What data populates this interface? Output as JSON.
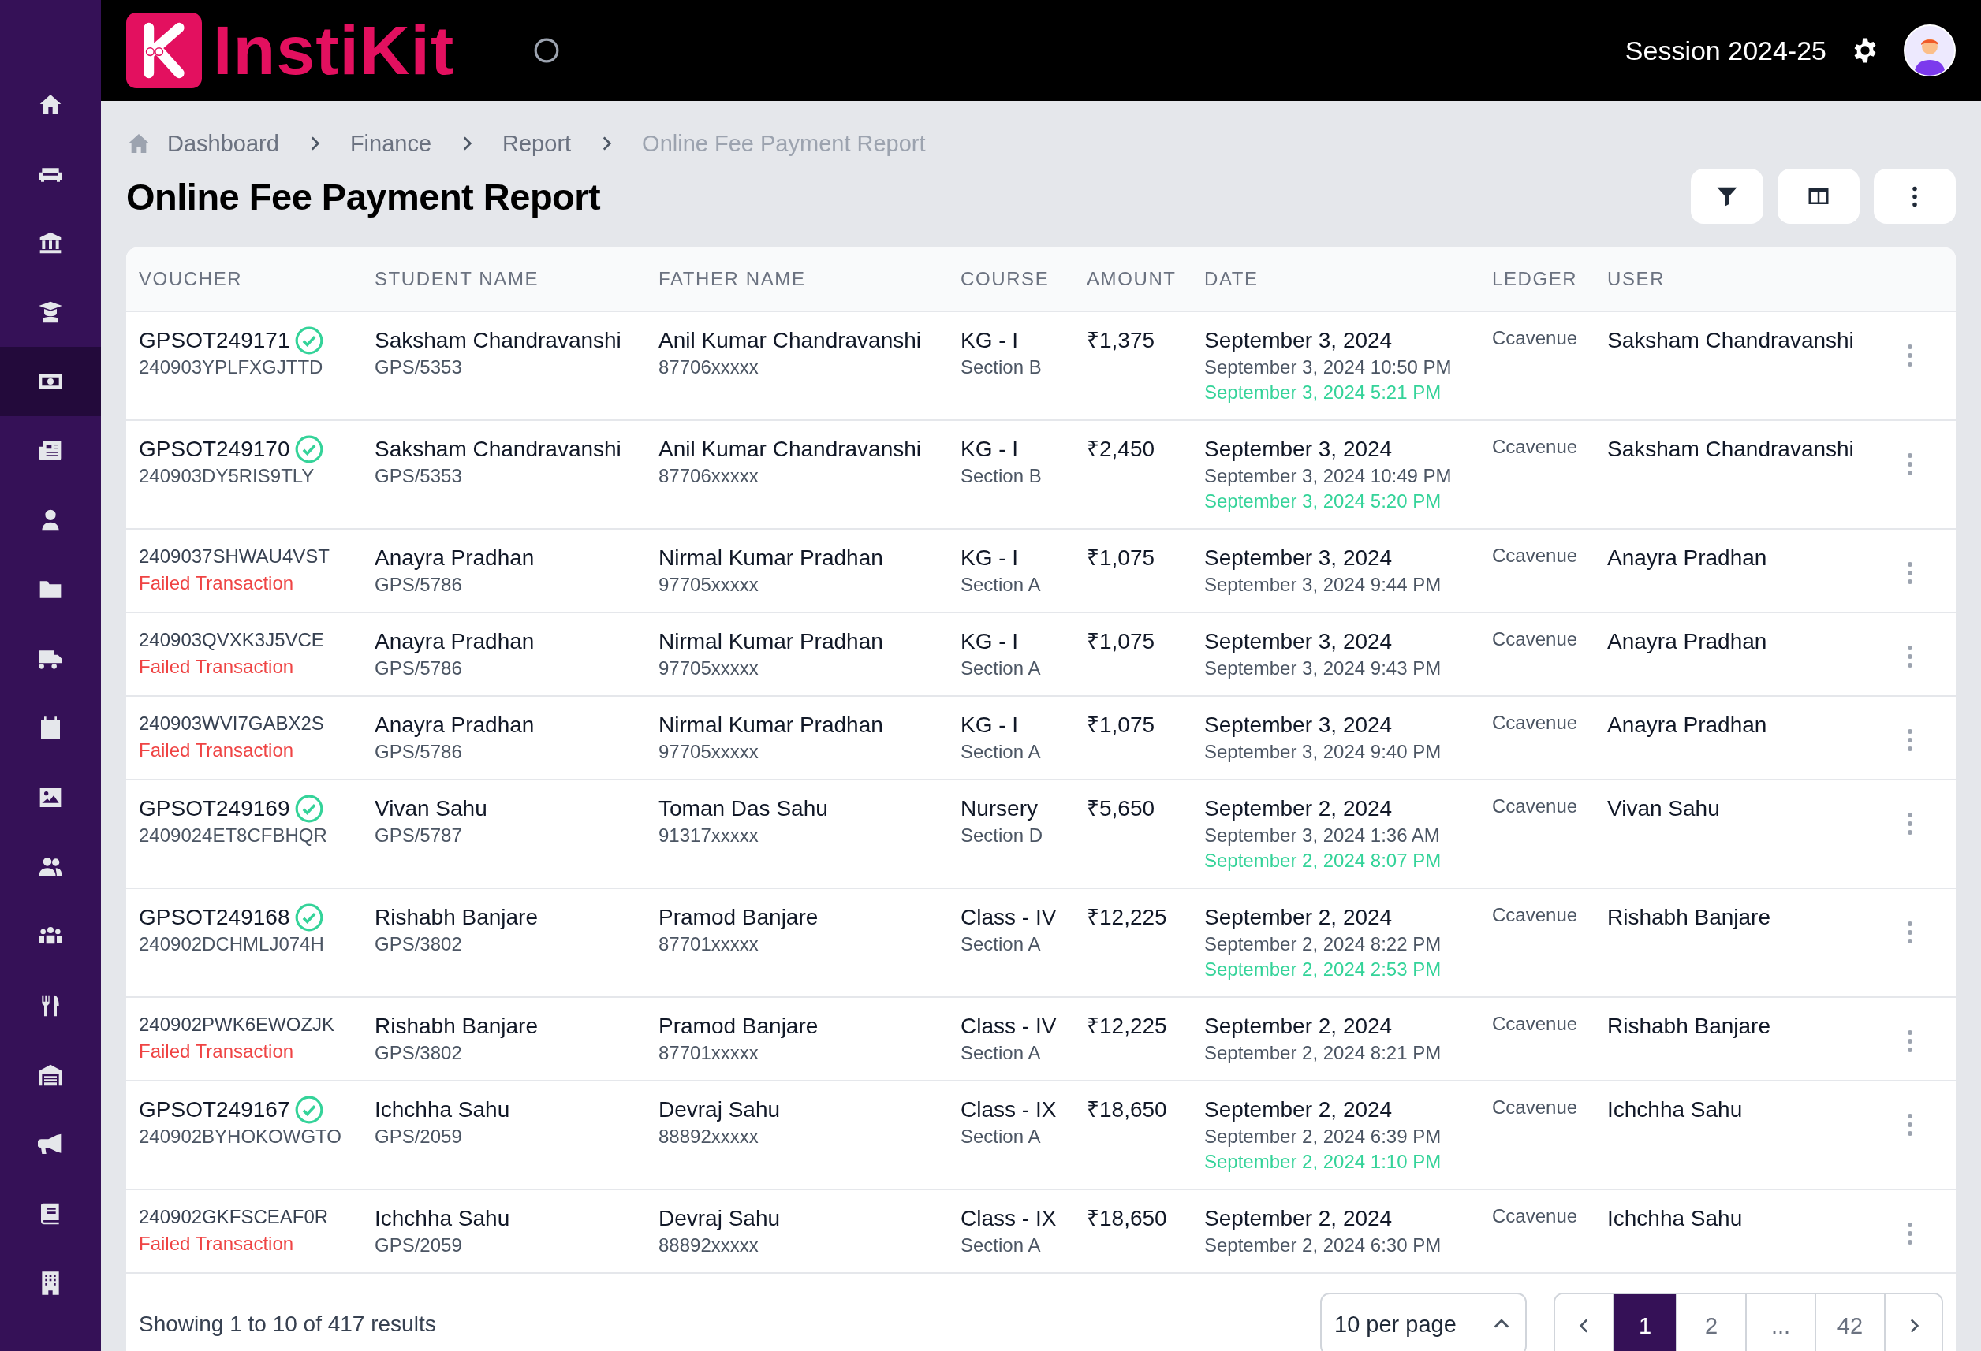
{
  "sidebar": {
    "items": [
      {
        "selected": false
      },
      {
        "selected": false
      },
      {
        "selected": false
      },
      {
        "selected": false
      },
      {
        "selected": true
      },
      {
        "selected": false
      },
      {
        "selected": false
      },
      {
        "selected": false
      },
      {
        "selected": false
      },
      {
        "selected": false
      },
      {
        "selected": false
      },
      {
        "selected": false
      },
      {
        "selected": false
      },
      {
        "selected": false
      },
      {
        "selected": false
      },
      {
        "selected": false
      },
      {
        "selected": false
      },
      {
        "selected": false
      }
    ]
  },
  "header": {
    "logo_text": "InstiKit",
    "session": "Session 2024-25"
  },
  "breadcrumb": [
    "Dashboard",
    "Finance",
    "Report",
    "Online Fee Payment Report"
  ],
  "title": "Online Fee Payment Report",
  "table": {
    "columns": [
      "VOUCHER",
      "STUDENT NAME",
      "FATHER NAME",
      "COURSE",
      "AMOUNT",
      "DATE",
      "LEDGER",
      "USER"
    ],
    "rows": [
      {
        "kind": "paid",
        "voucher_no": "GPSOT249171",
        "reference": "240903YPLFXGJTTD",
        "student": "Saksham Chandravanshi",
        "admission_no": "GPS/5353",
        "father": "Anil Kumar Chandravanshi",
        "contact": "87706xxxxx",
        "course": "KG - I",
        "section": "Section B",
        "amount": "₹1,375",
        "date": "September 3, 2024",
        "created_at": "September 3, 2024 10:50 PM",
        "paid_at": "September 3, 2024 5:21 PM",
        "ledger": "Ccavenue",
        "user": "Saksham Chandravanshi"
      },
      {
        "kind": "paid",
        "voucher_no": "GPSOT249170",
        "reference": "240903DY5RIS9TLY",
        "student": "Saksham Chandravanshi",
        "admission_no": "GPS/5353",
        "father": "Anil Kumar Chandravanshi",
        "contact": "87706xxxxx",
        "course": "KG - I",
        "section": "Section B",
        "amount": "₹2,450",
        "date": "September 3, 2024",
        "created_at": "September 3, 2024 10:49 PM",
        "paid_at": "September 3, 2024 5:20 PM",
        "ledger": "Ccavenue",
        "user": "Saksham Chandravanshi"
      },
      {
        "kind": "failed",
        "reference": "2409037SHWAU4VST",
        "status_text": "Failed Transaction",
        "student": "Anayra Pradhan",
        "admission_no": "GPS/5786",
        "father": "Nirmal Kumar Pradhan",
        "contact": "97705xxxxx",
        "course": "KG - I",
        "section": "Section A",
        "amount": "₹1,075",
        "date": "September 3, 2024",
        "created_at": "September 3, 2024 9:44 PM",
        "ledger": "Ccavenue",
        "user": "Anayra Pradhan"
      },
      {
        "kind": "failed",
        "reference": "240903QVXK3J5VCE",
        "status_text": "Failed Transaction",
        "student": "Anayra Pradhan",
        "admission_no": "GPS/5786",
        "father": "Nirmal Kumar Pradhan",
        "contact": "97705xxxxx",
        "course": "KG - I",
        "section": "Section A",
        "amount": "₹1,075",
        "date": "September 3, 2024",
        "created_at": "September 3, 2024 9:43 PM",
        "ledger": "Ccavenue",
        "user": "Anayra Pradhan"
      },
      {
        "kind": "failed",
        "reference": "240903WVI7GABX2S",
        "status_text": "Failed Transaction",
        "student": "Anayra Pradhan",
        "admission_no": "GPS/5786",
        "father": "Nirmal Kumar Pradhan",
        "contact": "97705xxxxx",
        "course": "KG - I",
        "section": "Section A",
        "amount": "₹1,075",
        "date": "September 3, 2024",
        "created_at": "September 3, 2024 9:40 PM",
        "ledger": "Ccavenue",
        "user": "Anayra Pradhan"
      },
      {
        "kind": "paid",
        "voucher_no": "GPSOT249169",
        "reference": "2409024ET8CFBHQR",
        "student": "Vivan Sahu",
        "admission_no": "GPS/5787",
        "father": "Toman Das Sahu",
        "contact": "91317xxxxx",
        "course": "Nursery",
        "section": "Section D",
        "amount": "₹5,650",
        "date": "September 2, 2024",
        "created_at": "September 3, 2024 1:36 AM",
        "paid_at": "September 2, 2024 8:07 PM",
        "ledger": "Ccavenue",
        "user": "Vivan Sahu"
      },
      {
        "kind": "paid",
        "voucher_no": "GPSOT249168",
        "reference": "240902DCHMLJ074H",
        "student": "Rishabh Banjare",
        "admission_no": "GPS/3802",
        "father": "Pramod Banjare",
        "contact": "87701xxxxx",
        "course": "Class - IV",
        "section": "Section A",
        "amount": "₹12,225",
        "date": "September 2, 2024",
        "created_at": "September 2, 2024 8:22 PM",
        "paid_at": "September 2, 2024 2:53 PM",
        "ledger": "Ccavenue",
        "user": "Rishabh Banjare"
      },
      {
        "kind": "failed",
        "reference": "240902PWK6EWOZJK",
        "status_text": "Failed Transaction",
        "student": "Rishabh Banjare",
        "admission_no": "GPS/3802",
        "father": "Pramod Banjare",
        "contact": "87701xxxxx",
        "course": "Class - IV",
        "section": "Section A",
        "amount": "₹12,225",
        "date": "September 2, 2024",
        "created_at": "September 2, 2024 8:21 PM",
        "ledger": "Ccavenue",
        "user": "Rishabh Banjare"
      },
      {
        "kind": "paid",
        "voucher_no": "GPSOT249167",
        "reference": "240902BYHOKOWGTO",
        "student": "Ichchha Sahu",
        "admission_no": "GPS/2059",
        "father": "Devraj Sahu",
        "contact": "88892xxxxx",
        "course": "Class - IX",
        "section": "Section A",
        "amount": "₹18,650",
        "date": "September 2, 2024",
        "created_at": "September 2, 2024 6:39 PM",
        "paid_at": "September 2, 2024 1:10 PM",
        "ledger": "Ccavenue",
        "user": "Ichchha Sahu"
      },
      {
        "kind": "failed",
        "reference": "240902GKFSCEAF0R",
        "status_text": "Failed Transaction",
        "student": "Ichchha Sahu",
        "admission_no": "GPS/2059",
        "father": "Devraj Sahu",
        "contact": "88892xxxxx",
        "course": "Class - IX",
        "section": "Section A",
        "amount": "₹18,650",
        "date": "September 2, 2024",
        "created_at": "September 2, 2024 6:30 PM",
        "ledger": "Ccavenue",
        "user": "Ichchha Sahu"
      }
    ]
  },
  "footer": {
    "summary": "Showing 1 to 10 of 417 results",
    "per_page": "10 per page",
    "pages": [
      {
        "label": "1",
        "selected": true
      },
      {
        "label": "2",
        "selected": false
      },
      {
        "label": "...",
        "selected": false
      },
      {
        "label": "42",
        "selected": false
      }
    ]
  }
}
